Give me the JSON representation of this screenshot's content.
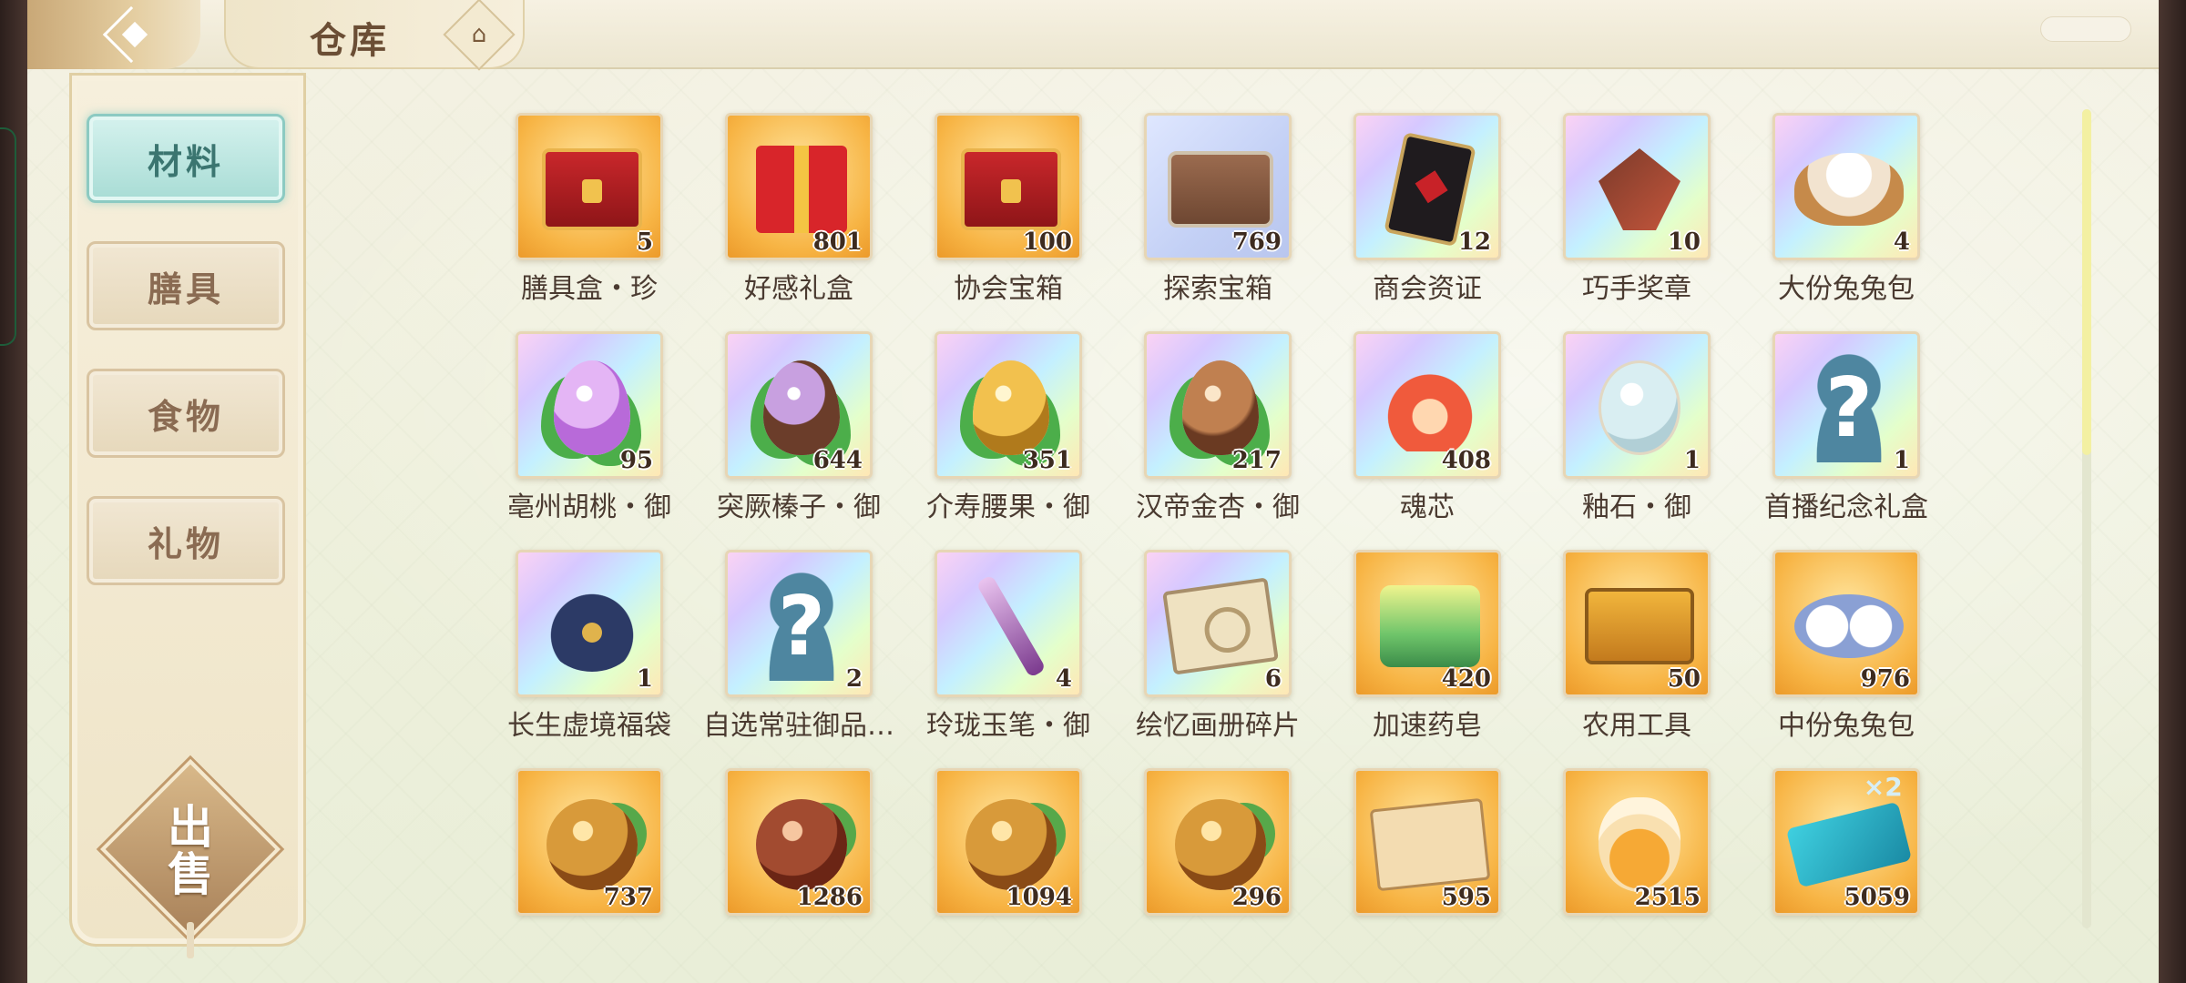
{
  "header": {
    "title": "仓库",
    "back_icon": "back-arrow-icon",
    "home_icon": "pavilion-icon"
  },
  "sidebar": {
    "tabs": [
      {
        "label": "材料",
        "active": true
      },
      {
        "label": "膳具",
        "active": false
      },
      {
        "label": "食物",
        "active": false
      },
      {
        "label": "礼物",
        "active": false
      }
    ],
    "sell_label": "出售"
  },
  "items": [
    {
      "name": "膳具盒・珍",
      "qty": "5",
      "bg": "gold",
      "icon": "red-chest-icon"
    },
    {
      "name": "好感礼盒",
      "qty": "801",
      "bg": "gold",
      "icon": "gift-box-icon"
    },
    {
      "name": "协会宝箱",
      "qty": "100",
      "bg": "gold",
      "icon": "treasure-chest-icon"
    },
    {
      "name": "探索宝箱",
      "qty": "769",
      "bg": "blue",
      "icon": "wooden-chest-icon"
    },
    {
      "name": "商会资证",
      "qty": "12",
      "bg": "rainbow",
      "icon": "card-icon"
    },
    {
      "name": "巧手奖章",
      "qty": "10",
      "bg": "rainbow",
      "icon": "medal-icon"
    },
    {
      "name": "大份兔兔包",
      "qty": "4",
      "bg": "rainbow",
      "icon": "steamed-bun-basket-icon"
    },
    {
      "name": "亳州胡桃・御",
      "qty": "95",
      "bg": "rainbow",
      "icon": "walnut-icon"
    },
    {
      "name": "突厥榛子・御",
      "qty": "644",
      "bg": "rainbow",
      "icon": "hazelnut-icon"
    },
    {
      "name": "介寿腰果・御",
      "qty": "351",
      "bg": "rainbow",
      "icon": "cashew-icon"
    },
    {
      "name": "汉帝金杏・御",
      "qty": "217",
      "bg": "rainbow",
      "icon": "apricot-icon"
    },
    {
      "name": "魂芯",
      "qty": "408",
      "bg": "rainbow",
      "icon": "flame-core-icon"
    },
    {
      "name": "釉石・御",
      "qty": "1",
      "bg": "rainbow",
      "icon": "glaze-stone-icon"
    },
    {
      "name": "首播纪念礼盒",
      "qty": "1",
      "bg": "rainbow",
      "icon": "question-mark-icon"
    },
    {
      "name": "长生虚境福袋",
      "qty": "1",
      "bg": "rainbow",
      "icon": "lucky-bag-icon"
    },
    {
      "name": "自选常驻御品…",
      "qty": "2",
      "bg": "rainbow",
      "icon": "question-mark-icon"
    },
    {
      "name": "玲珑玉笔・御",
      "qty": "4",
      "bg": "rainbow",
      "icon": "jade-pen-icon"
    },
    {
      "name": "绘忆画册碎片",
      "qty": "6",
      "bg": "rainbow",
      "icon": "album-fragment-icon"
    },
    {
      "name": "加速药皂",
      "qty": "420",
      "bg": "gold",
      "icon": "soap-icon"
    },
    {
      "name": "农用工具",
      "qty": "50",
      "bg": "gold",
      "icon": "toolbox-icon"
    },
    {
      "name": "中份兔兔包",
      "qty": "976",
      "bg": "gold",
      "icon": "rabbit-bun-icon"
    },
    {
      "name": "",
      "qty": "737",
      "bg": "gold",
      "icon": "walnut-gold-icon"
    },
    {
      "name": "",
      "qty": "1286",
      "bg": "gold",
      "icon": "hazelnut-gold-icon"
    },
    {
      "name": "",
      "qty": "1094",
      "bg": "gold",
      "icon": "cashew-gold-icon"
    },
    {
      "name": "",
      "qty": "296",
      "bg": "gold",
      "icon": "apricot-gold-icon"
    },
    {
      "name": "",
      "qty": "595",
      "bg": "gold",
      "icon": "recipe-scroll-icon"
    },
    {
      "name": "",
      "qty": "2515",
      "bg": "gold",
      "icon": "potion-icon"
    },
    {
      "name": "",
      "qty": "5059",
      "bg": "gold",
      "icon": "ticket-icon"
    }
  ],
  "colors": {
    "active_tab": "#a8dcd5",
    "gold_bg": "#f7b444",
    "text": "#4a3a30"
  }
}
